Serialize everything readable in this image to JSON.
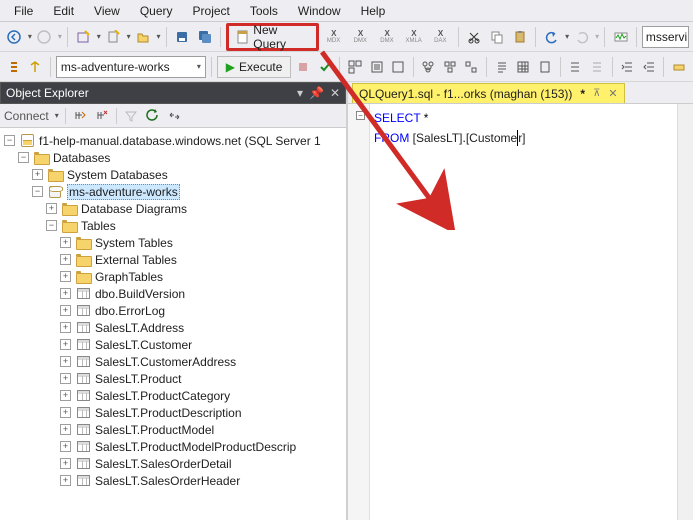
{
  "menu": [
    "File",
    "Edit",
    "View",
    "Query",
    "Project",
    "Tools",
    "Window",
    "Help"
  ],
  "toolbar1": {
    "new_query_label": "New Query",
    "d1": "▾",
    "d2": "▾",
    "d3": "▾",
    "d4": "▾",
    "x_labels": [
      "X",
      "X",
      "X",
      "X",
      "X"
    ],
    "x_sub": [
      "MDX",
      "DMX",
      "DMX",
      "XMLA",
      "DAX"
    ],
    "combo_right": "msservi"
  },
  "toolbar2": {
    "db_combo": "ms-adventure-works",
    "execute_label": "Execute"
  },
  "object_explorer": {
    "title": "Object Explorer",
    "connect_label": "Connect",
    "server": "f1-help-manual.database.windows.net (SQL Server 1",
    "nodes": {
      "databases": "Databases",
      "sysdb": "System Databases",
      "userdb": "ms-adventure-works",
      "dbdiag": "Database Diagrams",
      "tables": "Tables",
      "systables": "System Tables",
      "exttables": "External Tables",
      "graphtables": "GraphTables",
      "t0": "dbo.BuildVersion",
      "t1": "dbo.ErrorLog",
      "t2": "SalesLT.Address",
      "t3": "SalesLT.Customer",
      "t4": "SalesLT.CustomerAddress",
      "t5": "SalesLT.Product",
      "t6": "SalesLT.ProductCategory",
      "t7": "SalesLT.ProductDescription",
      "t8": "SalesLT.ProductModel",
      "t9": "SalesLT.ProductModelProductDescrip",
      "t10": "SalesLT.SalesOrderDetail",
      "t11": "SalesLT.SalesOrderHeader"
    }
  },
  "editor": {
    "tab_label": "QLQuery1.sql - f1...orks (maghan (153))",
    "dirty_marker": "*",
    "line1_kw": "SELECT",
    "line1_rest": " *",
    "line2_kw": "FROM",
    "line2_sp": " ",
    "line2_b1": "[SalesLT]",
    "line2_dot": ".",
    "line2_b2a": "[Custome",
    "line2_b2b": "r]"
  }
}
